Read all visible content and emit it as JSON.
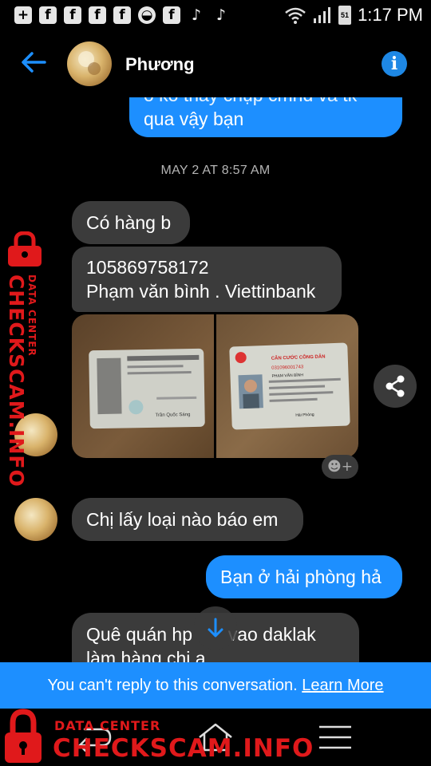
{
  "status_bar": {
    "time": "1:17 PM",
    "battery": "51",
    "icons": [
      "add-icon",
      "facebook-icon",
      "facebook-icon",
      "facebook-icon",
      "facebook-icon",
      "circle-icon",
      "facebook-icon",
      "tiktok-icon",
      "tiktok-icon",
      "wifi-icon",
      "signal-icon",
      "battery-icon"
    ]
  },
  "header": {
    "contact_name": "Phương",
    "back_icon": "arrow-left-icon",
    "info_icon": "info-icon"
  },
  "messages": {
    "top_partial_line1": "ô ko thấy chụp cmnd và tk",
    "top_partial_line2": "qua vậy bạn",
    "timestamp": "MAY 2 AT 8:57 AM",
    "m1": "Có hàng b",
    "m2_line1": "105869758172",
    "m2_line2": "Phạm văn bình . Viettinbank",
    "m3": "Chị lấy loại nào báo em",
    "m4": "Bạn ở hải phòng hả",
    "m5_line1": "Quê quán hp       vao daklak",
    "m5_line2": "làm hàng chị a"
  },
  "id_card": {
    "title": "CĂN CƯỚC CÔNG DÂN",
    "number": "031096001743",
    "name": "PHẠM VĂN BÌNH",
    "place": "Hải Phòng",
    "back_signer": "Trần Quốc Sáng"
  },
  "footer": {
    "notice": "You can't reply to this conversation.",
    "learn_more": "Learn More"
  },
  "watermark": {
    "small": "DATA CENTER",
    "big": "CHECKSCAM.INFO"
  },
  "colors": {
    "accent": "#1d8fff",
    "incoming_bubble": "#3b3b3b",
    "watermark": "#e0191b"
  }
}
